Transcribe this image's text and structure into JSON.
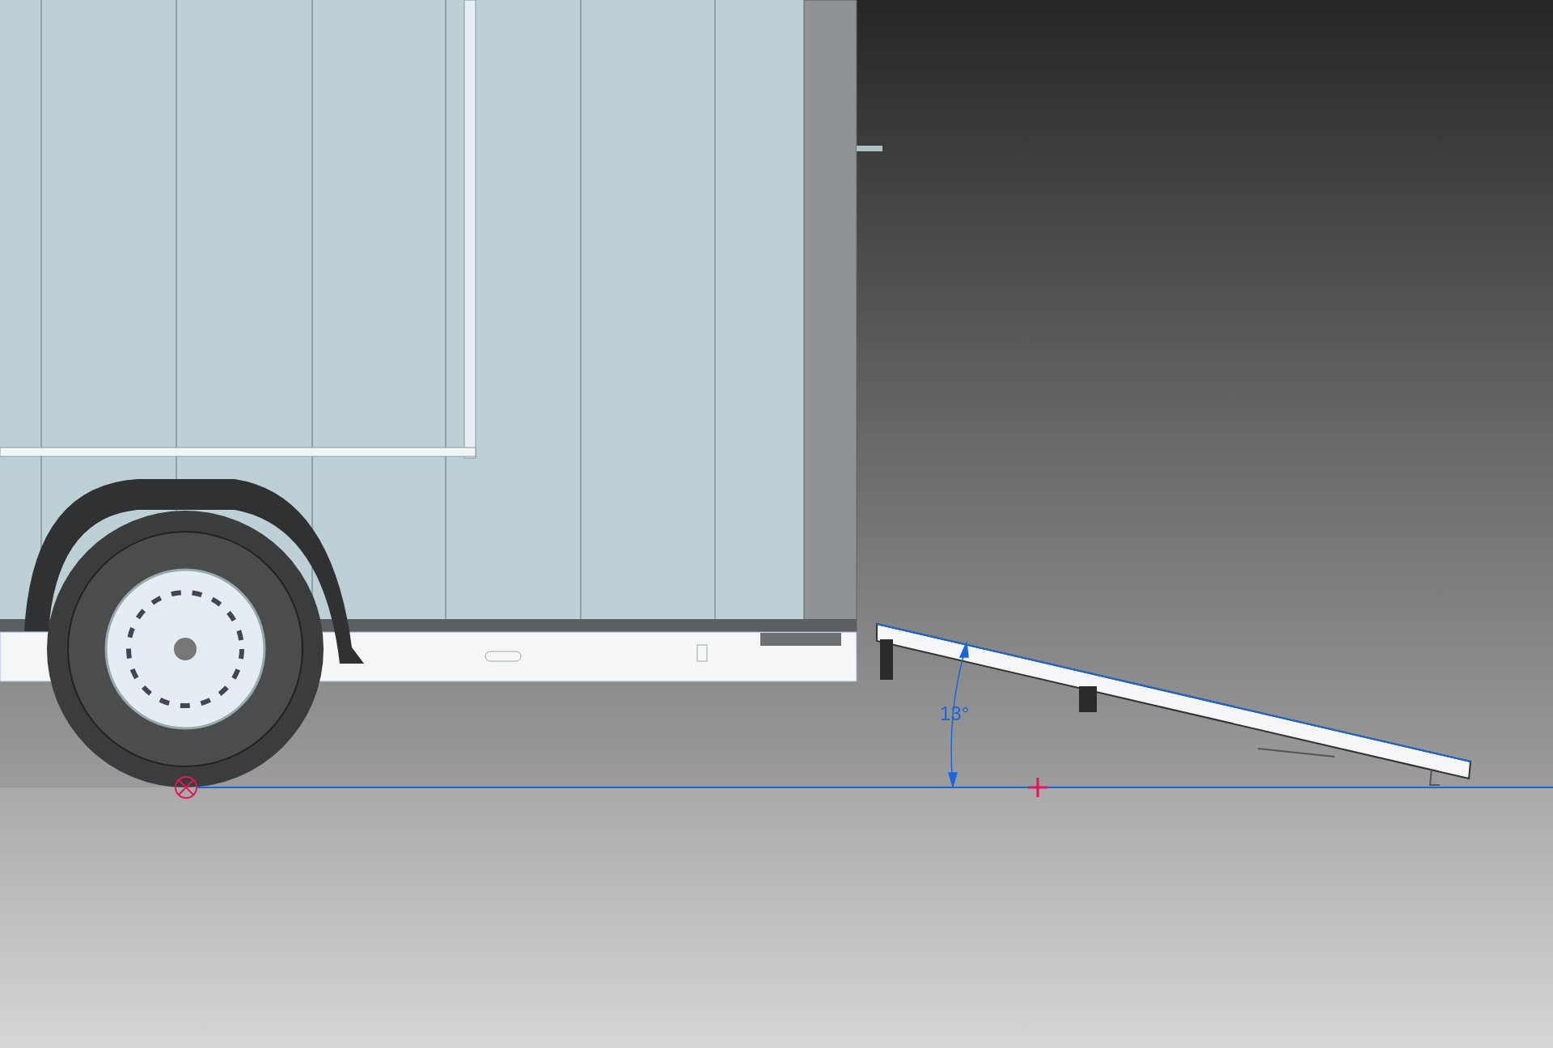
{
  "viewport": {
    "angle_dimension": {
      "text": "13°"
    }
  }
}
